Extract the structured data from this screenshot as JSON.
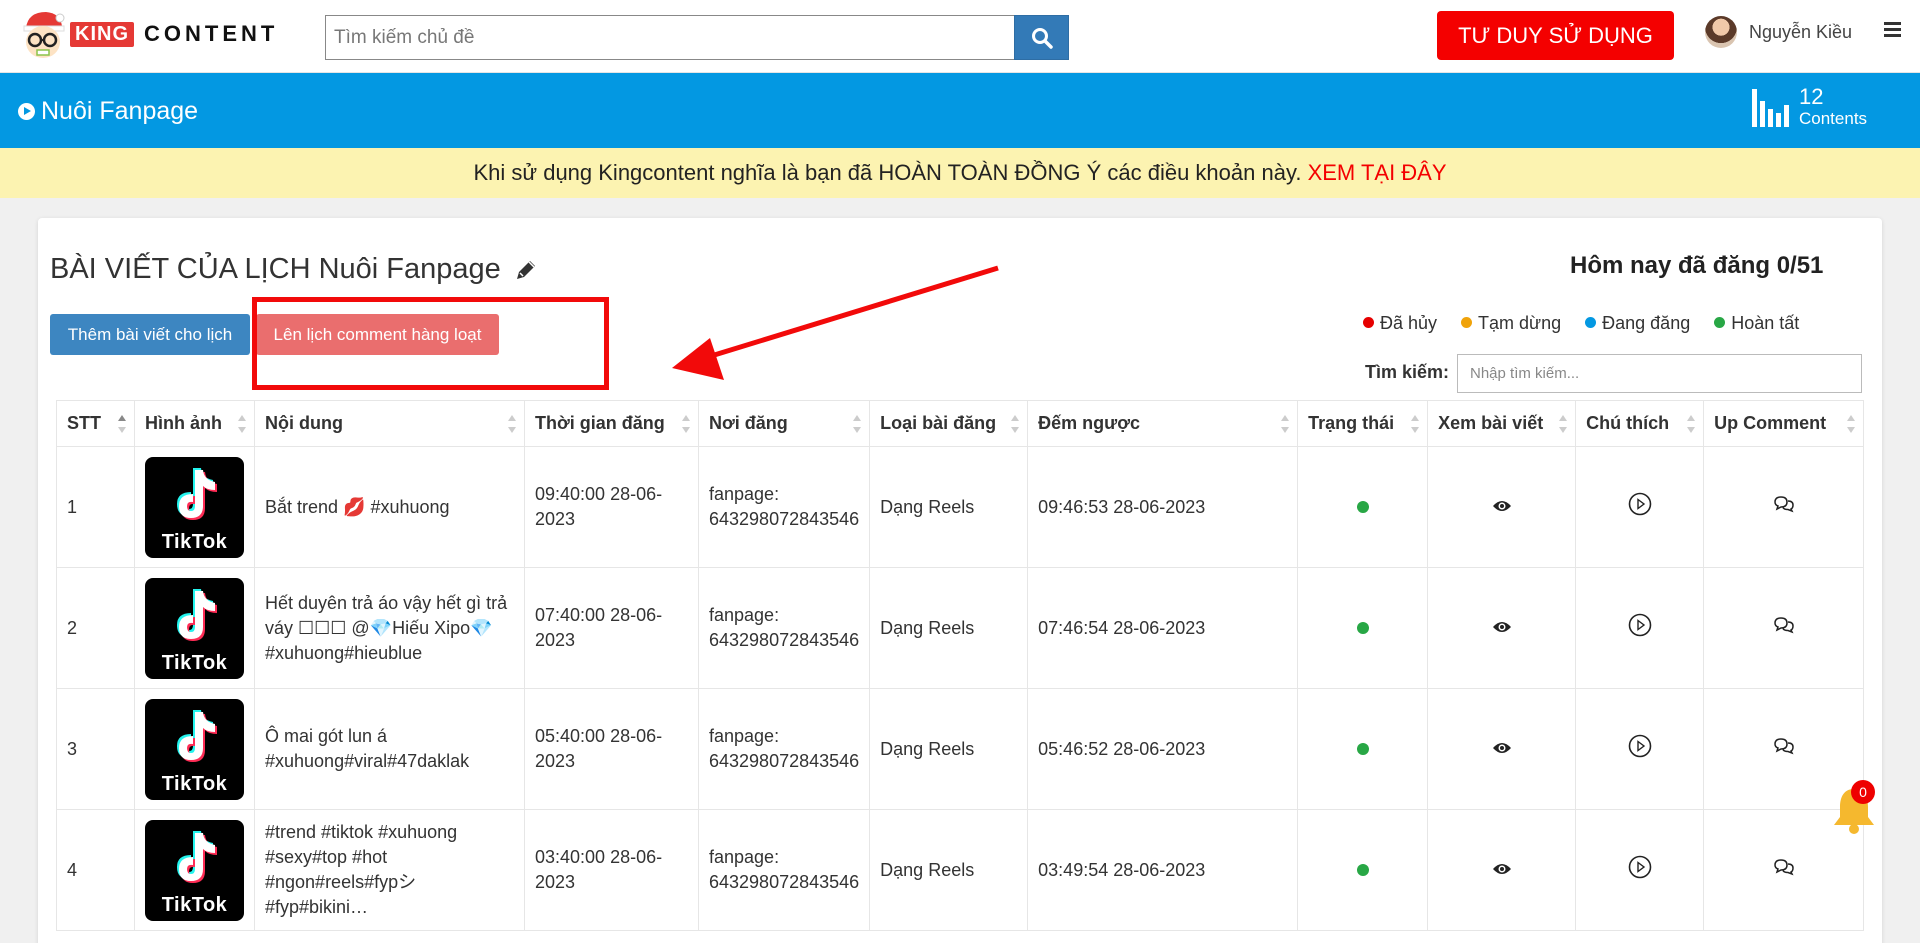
{
  "header": {
    "logo_king": "KING",
    "logo_content": "CONTENT",
    "search_placeholder": "Tìm kiếm chủ đề",
    "cta_label": "TƯ DUY SỬ DỤNG",
    "user_name": "Nguyễn Kiều"
  },
  "section": {
    "title": "Nuôi Fanpage",
    "count": "12",
    "count_label": "Contents"
  },
  "notice": {
    "text": "Khi sử dụng Kingcontent nghĩa là bạn đã HOÀN TOÀN ĐỒNG Ý các điều khoản này.",
    "link": "XEM TẠI ĐÂY"
  },
  "page": {
    "title": "BÀI VIẾT CỦA LỊCH Nuôi Fanpage",
    "today": "Hôm nay đã đăng 0/51",
    "add_button": "Thêm bài viết cho lịch",
    "schedule_button": "Lên lịch comment hàng loạt",
    "search_label": "Tìm kiếm:",
    "search_placeholder": "Nhập tìm kiếm..."
  },
  "legend": [
    {
      "label": "Đã hủy",
      "color": "#e60000"
    },
    {
      "label": "Tạm dừng",
      "color": "#f0a30a"
    },
    {
      "label": "Đang đăng",
      "color": "#0398e2"
    },
    {
      "label": "Hoàn tất",
      "color": "#28a745"
    }
  ],
  "table": {
    "headers": [
      "STT",
      "Hình ảnh",
      "Nội dung",
      "Thời gian đăng",
      "Nơi đăng",
      "Loại bài đăng",
      "Đếm ngược",
      "Trạng thái",
      "Xem bài viết",
      "Chú thích",
      "Up Comment"
    ],
    "thumb_label": "TikTok",
    "rows": [
      {
        "stt": "1",
        "content": "Bắt trend 💋 #xuhuong",
        "time": "09:40:00 28-06-2023",
        "place": "fanpage: 643298072843546",
        "type": "Dạng Reels",
        "countdown": "09:46:53 28-06-2023"
      },
      {
        "stt": "2",
        "content": "Hết duyên trả áo vậy hết gì trả váy ☐☐☐ @💎Hiếu Xipo💎 #xuhuong#hieublue",
        "time": "07:40:00 28-06-2023",
        "place": "fanpage: 643298072843546",
        "type": "Dạng Reels",
        "countdown": "07:46:54 28-06-2023"
      },
      {
        "stt": "3",
        "content": "Ô mai gót lun á #xuhuong#viral#47daklak",
        "time": "05:40:00 28-06-2023",
        "place": "fanpage: 643298072843546",
        "type": "Dạng Reels",
        "countdown": "05:46:52 28-06-2023"
      },
      {
        "stt": "4",
        "content": "#trend #tiktok #xuhuong #sexy#top #hot #ngon#reels#fypシ#fyp#bikini…",
        "time": "03:40:00 28-06-2023",
        "place": "fanpage: 643298072843546",
        "type": "Dạng Reels",
        "countdown": "03:49:54 28-06-2023"
      }
    ]
  },
  "notifications": {
    "count": "0"
  },
  "colors": {
    "brand_blue": "#0398e2",
    "cta_red": "#f40000",
    "notice_bg": "#fcf3b1",
    "status_done": "#28a745"
  }
}
